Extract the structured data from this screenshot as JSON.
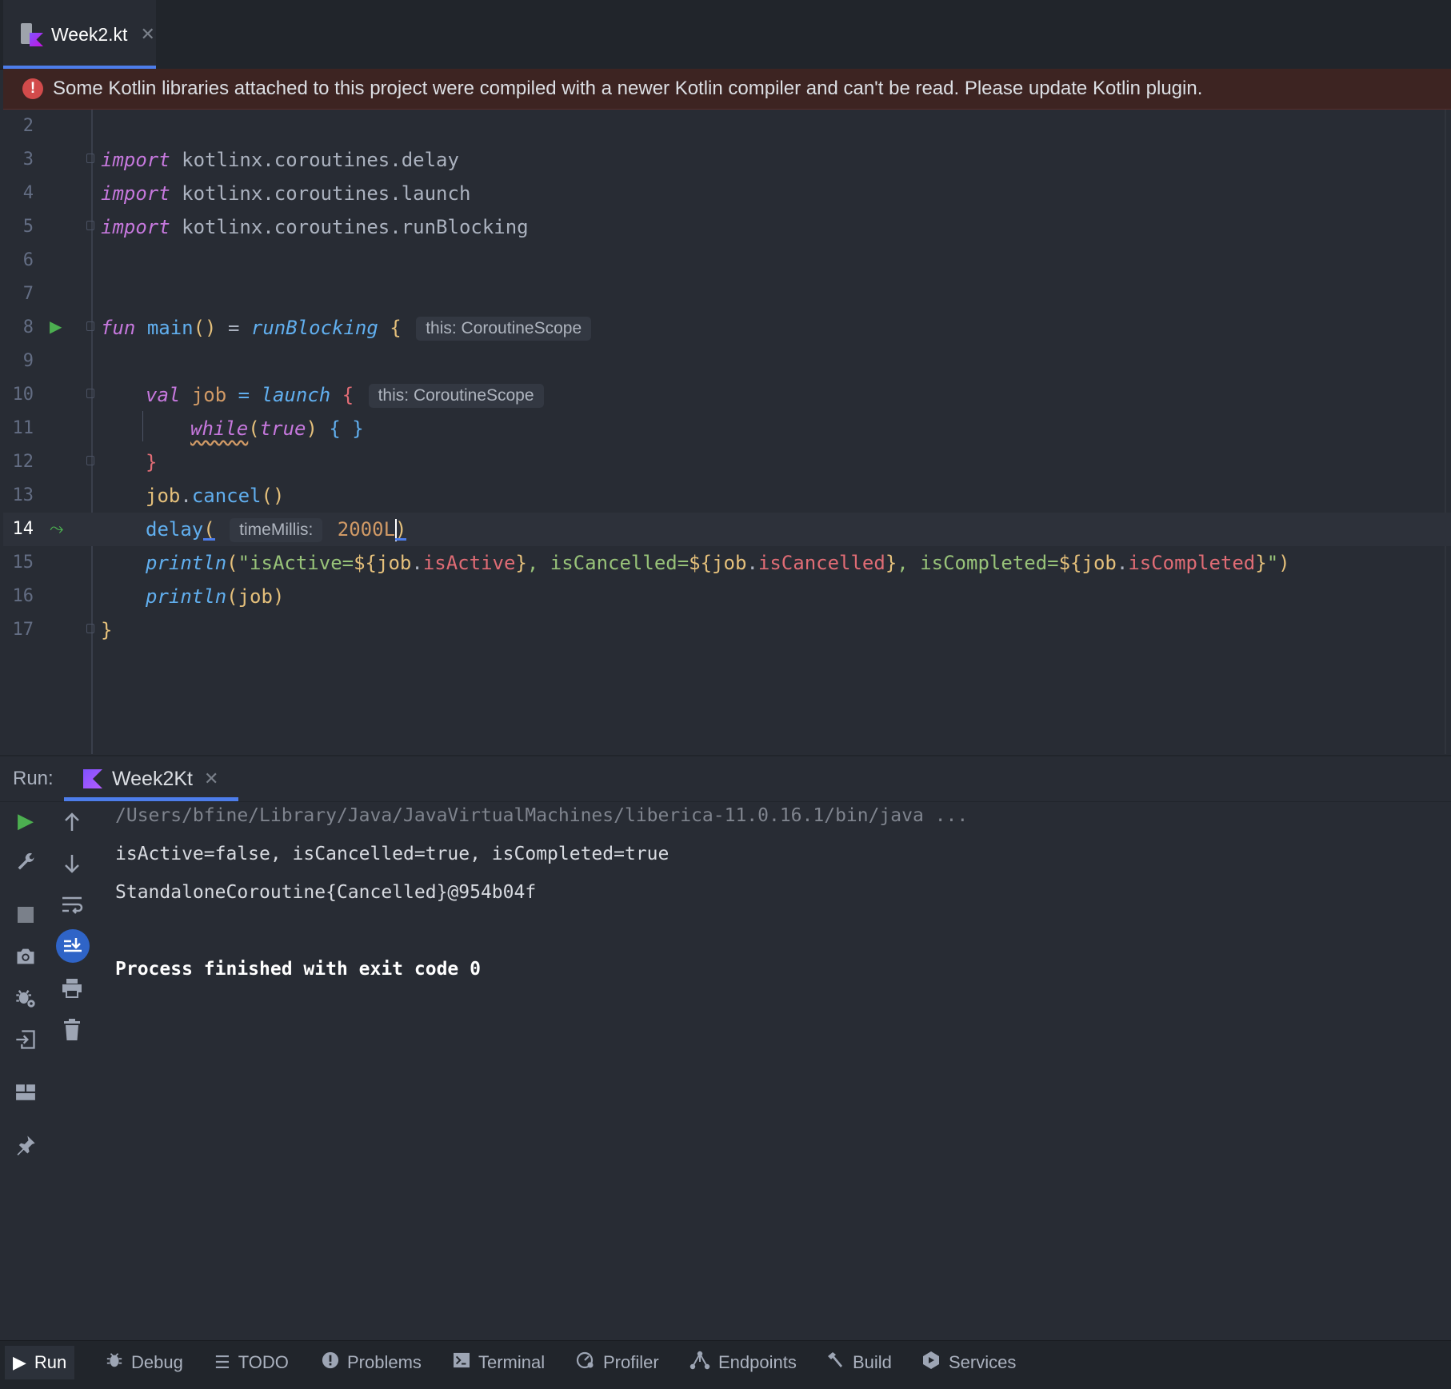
{
  "editor_tab": {
    "file_name": "Week2.kt"
  },
  "banner": {
    "message": "Some Kotlin libraries attached to this project were compiled with a newer Kotlin compiler and can't be read. Please update Kotlin plugin."
  },
  "code_lines": {
    "n2": "2",
    "n3": "3",
    "n4": "4",
    "n5": "5",
    "n6": "6",
    "n7": "7",
    "n8": "8",
    "n9": "9",
    "n10": "10",
    "n11": "11",
    "n12": "12",
    "n13": "13",
    "n14": "14",
    "n15": "15",
    "n16": "16",
    "n17": "17"
  },
  "code": {
    "import_kw": "import",
    "import1": "kotlinx.coroutines.delay",
    "import2": "kotlinx.coroutines.launch",
    "import3": "kotlinx.coroutines.runBlocking",
    "fun_kw": "fun",
    "main": "main",
    "run_blocking": "runBlocking",
    "hint_this": "this: CoroutineScope",
    "val_kw": "val",
    "job": "job",
    "launch": "launch",
    "while_kw": "while",
    "true_kw": "true",
    "cancel": "cancel",
    "delay": "delay",
    "hint_time": "timeMillis:",
    "delay_value": "2000L",
    "println": "println",
    "str_is_active": "\"isActive=",
    "is_active": "isActive",
    "str_is_cancelled": ", isCancelled=",
    "is_cancelled": "isCancelled",
    "str_is_completed": ", isCompleted=",
    "is_completed": "isCompleted"
  },
  "run_panel": {
    "label": "Run:",
    "tab_name": "Week2Kt",
    "console": [
      "/Users/bfine/Library/Java/JavaVirtualMachines/liberica-11.0.16.1/bin/java ...",
      "isActive=false, isCancelled=true, isCompleted=true",
      "StandaloneCoroutine{Cancelled}@954b04f",
      "Process finished with exit code 0"
    ]
  },
  "bottom_bar": {
    "run": "Run",
    "debug": "Debug",
    "todo": "TODO",
    "problems": "Problems",
    "terminal": "Terminal",
    "profiler": "Profiler",
    "endpoints": "Endpoints",
    "build": "Build",
    "services": "Services"
  },
  "colors": {
    "accent": "#4d7dea",
    "run_green": "#4caf50",
    "error_red": "#d24b4b",
    "keyword": "#c678dd",
    "function": "#61afef",
    "string": "#98c379",
    "number": "#d19a66"
  }
}
